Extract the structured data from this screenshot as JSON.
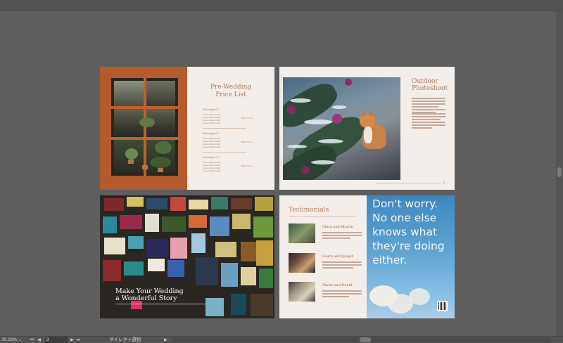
{
  "artboards": {
    "price_list": {
      "title_line1": "Pre-Wedding",
      "title_line2": "Price List",
      "packages": [
        {
          "name": "Package 01",
          "lines": [
            "Lorem Ipsum Dolor",
            "Lorem Ipsum Dolor",
            "Lorem Ipsum Dolor",
            "Lorem Ipsum Dolor"
          ],
          "price": "USD Xxxx.xx"
        },
        {
          "name": "Package 02",
          "lines": [
            "Lorem Ipsum Dolor",
            "Lorem Ipsum Dolor",
            "Lorem Ipsum Dolor",
            "Lorem Ipsum Dolor"
          ],
          "price": "USD Xxxx.xx"
        },
        {
          "name": "Package 03",
          "lines": [
            "Lorem Ipsum Dolor",
            "Lorem Ipsum Dolor",
            "Lorem Ipsum Dolor",
            "Lorem Ipsum Dolor"
          ],
          "price": "USD Xxxx.xx"
        }
      ]
    },
    "outdoor": {
      "title_line1": "Outdoor",
      "title_line2": "Photoshoot",
      "page_number": "11"
    },
    "story": {
      "headline_line1": "Make Your Wedding",
      "headline_line2": "a Wonderful Story"
    },
    "testimonials": {
      "title": "Testimonials",
      "items": [
        {
          "name": "Clara and Martin"
        },
        {
          "name": "Laura and Joseph"
        },
        {
          "name": "Marie and David"
        }
      ],
      "quote": "Don't worry. No one else knows what they're doing either."
    }
  },
  "statusbar": {
    "zoom": "30.02%",
    "page": "3",
    "tool_status": "ダイレクト選択"
  },
  "colors": {
    "accent": "#b47a5a",
    "rust": "#b45a2e",
    "artboard_bg": "#f3eeea",
    "workspace": "#5e5e5e"
  }
}
